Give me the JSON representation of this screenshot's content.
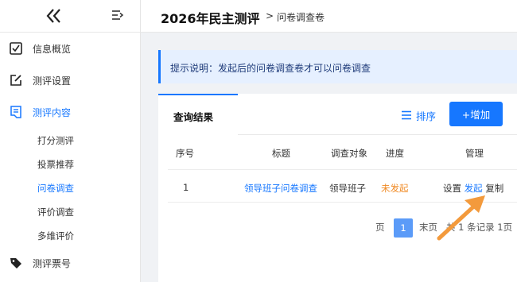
{
  "sidebar": {
    "items": [
      {
        "label": "信息概览"
      },
      {
        "label": "测评设置"
      },
      {
        "label": "测评内容"
      },
      {
        "label": "测评票号"
      }
    ],
    "subitems": [
      {
        "label": "打分测评"
      },
      {
        "label": "投票推荐"
      },
      {
        "label": "问卷调查"
      },
      {
        "label": "评价调查"
      },
      {
        "label": "多维评价"
      }
    ]
  },
  "header": {
    "title": "2026年民主测评",
    "separator": ">",
    "subtitle": "问卷调查卷"
  },
  "notice": {
    "text": "提示说明：发起后的问卷调查卷才可以问卷调查"
  },
  "card": {
    "tab": "查询结果",
    "sort_label": "排序",
    "add_label": "+增加",
    "columns": [
      "序号",
      "标题",
      "调查对象",
      "进度",
      "管理"
    ],
    "rows": [
      {
        "index": "1",
        "title": "领导班子问卷调查",
        "target": "领导班子",
        "status": "未发起",
        "actions": [
          "设置",
          "发起",
          "复制"
        ]
      }
    ],
    "pagination": {
      "prev_partial": "页",
      "current": "1",
      "last": "末页",
      "summary": "共 1 条记录 1页"
    }
  },
  "colors": {
    "accent": "#1677ff",
    "warning": "#f08a24",
    "annotation_arrow": "#f39a3c"
  }
}
